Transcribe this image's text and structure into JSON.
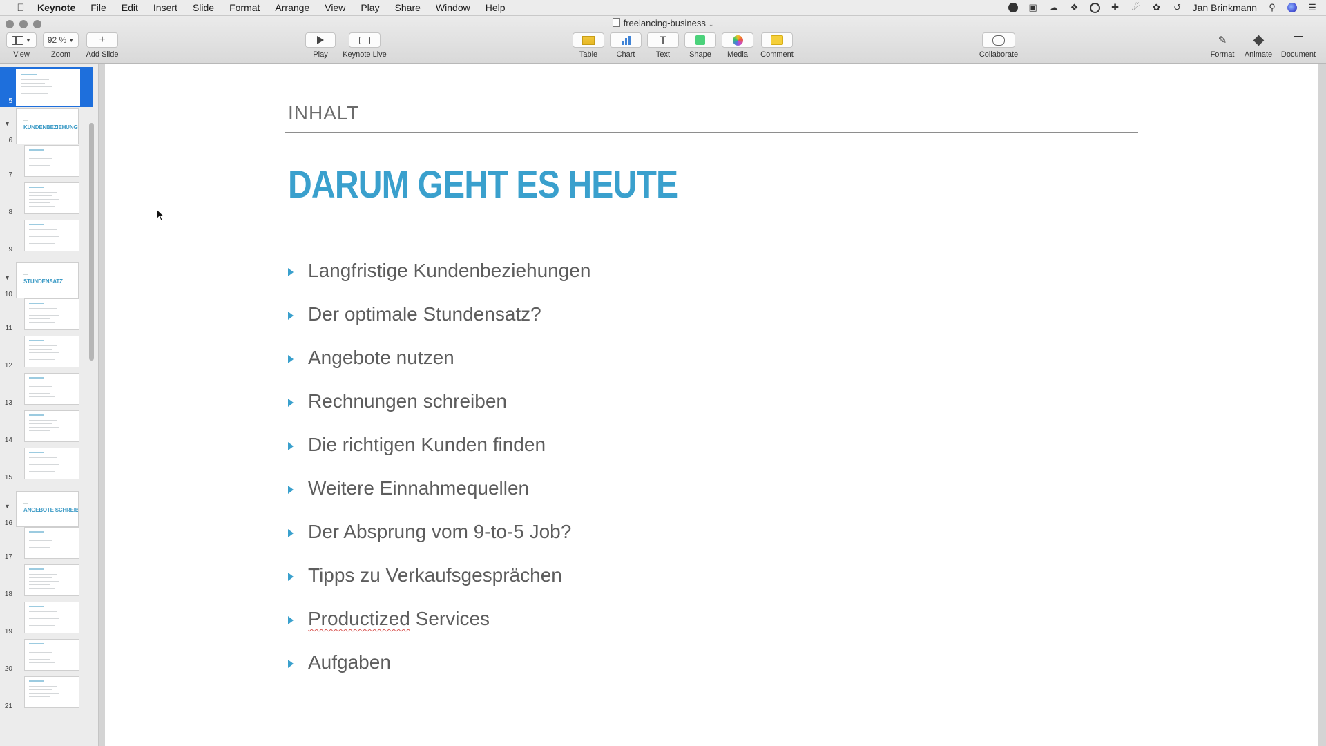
{
  "menubar": {
    "app_name": "Keynote",
    "menus": [
      "File",
      "Edit",
      "Insert",
      "Slide",
      "Format",
      "Arrange",
      "View",
      "Play",
      "Share",
      "Window",
      "Help"
    ],
    "user": "Jan Brinkmann"
  },
  "window": {
    "document_title": "freelancing-business"
  },
  "toolbar": {
    "view_label": "View",
    "zoom_value": "92 %",
    "zoom_label": "Zoom",
    "add_slide_label": "Add Slide",
    "play_label": "Play",
    "keynote_live_label": "Keynote Live",
    "table_label": "Table",
    "chart_label": "Chart",
    "text_label": "Text",
    "shape_label": "Shape",
    "media_label": "Media",
    "comment_label": "Comment",
    "collaborate_label": "Collaborate",
    "format_label": "Format",
    "animate_label": "Animate",
    "document_label": "Document"
  },
  "navigator": {
    "selected_slide": 5,
    "slides": [
      {
        "num": "5",
        "type": "content",
        "title": ""
      },
      {
        "num": "6",
        "type": "section",
        "title": "KUNDENBEZIEHUNGEN"
      },
      {
        "num": "7",
        "type": "content",
        "title": ""
      },
      {
        "num": "8",
        "type": "content",
        "title": ""
      },
      {
        "num": "9",
        "type": "content",
        "title": ""
      },
      {
        "num": "10",
        "type": "section",
        "title": "STUNDENSATZ"
      },
      {
        "num": "11",
        "type": "content",
        "title": ""
      },
      {
        "num": "12",
        "type": "content",
        "title": ""
      },
      {
        "num": "13",
        "type": "content",
        "title": ""
      },
      {
        "num": "14",
        "type": "content",
        "title": ""
      },
      {
        "num": "15",
        "type": "content",
        "title": ""
      },
      {
        "num": "16",
        "type": "section",
        "title": "ANGEBOTE SCHREIBEN"
      },
      {
        "num": "17",
        "type": "content",
        "title": ""
      },
      {
        "num": "18",
        "type": "content",
        "title": ""
      },
      {
        "num": "19",
        "type": "content",
        "title": ""
      },
      {
        "num": "20",
        "type": "content",
        "title": ""
      },
      {
        "num": "21",
        "type": "content",
        "title": ""
      }
    ]
  },
  "slide": {
    "heading": "INHALT",
    "title": "DARUM GEHT ES HEUTE",
    "bullets": [
      "Langfristige Kundenbeziehungen",
      "Der optimale Stundensatz?",
      "Angebote nutzen",
      "Rechnungen schreiben",
      "Die richtigen Kunden finden",
      "Weitere Einnahmequellen",
      "Der Absprung vom 9-to-5 Job?",
      "Tipps zu Verkaufsgesprächen",
      "Productized Services",
      "Aufgaben"
    ],
    "misspelled_word": "Productized",
    "accent_color": "#3aa0cd"
  }
}
